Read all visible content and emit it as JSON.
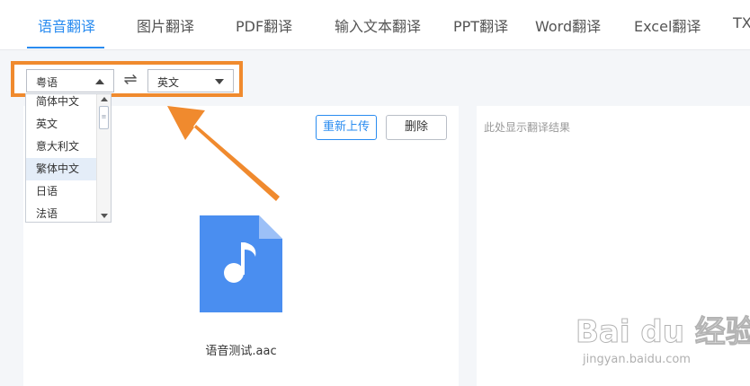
{
  "tabs": [
    {
      "label": "语音翻译",
      "active": true
    },
    {
      "label": "图片翻译",
      "active": false
    },
    {
      "label": "PDF翻译",
      "active": false
    },
    {
      "label": "输入文本翻译",
      "active": false
    },
    {
      "label": "PPT翻译",
      "active": false
    },
    {
      "label": "Word翻译",
      "active": false
    },
    {
      "label": "Excel翻译",
      "active": false
    },
    {
      "label": "TX",
      "active": false
    }
  ],
  "lang_bar": {
    "source": "粤语",
    "target": "英文",
    "swap_icon": "swap-arrows-icon"
  },
  "dropdown": {
    "items": [
      "简体中文",
      "英文",
      "意大利文",
      "繁体中文",
      "日语",
      "法语"
    ],
    "selected": "繁体中文"
  },
  "upload_panel": {
    "reupload_label": "重新上传",
    "delete_label": "删除",
    "file_icon": "audio-file-icon",
    "file_name": "语音测试.aac"
  },
  "result_panel": {
    "placeholder": "此处显示翻译结果"
  },
  "watermark": {
    "logo": "Bai du 经验",
    "url": "jingyan.baidu.com"
  },
  "colors": {
    "accent": "#2a8cf0",
    "highlight": "#f08a2e",
    "file_icon": "#4a8ef0"
  }
}
